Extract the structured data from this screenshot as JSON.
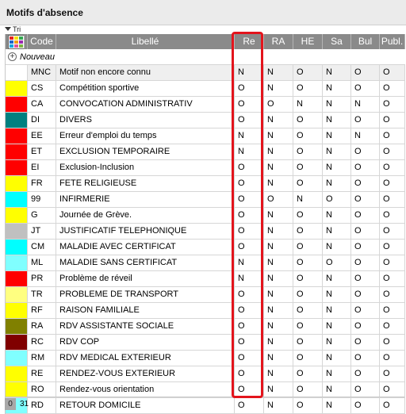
{
  "title": "Motifs d'absence",
  "sort_label": "Tri",
  "new_label": "Nouveau",
  "columns": [
    "Code",
    "Libellé",
    "Re",
    "RA",
    "HE",
    "Sa",
    "Bul",
    "Publ."
  ],
  "palette_colors": [
    "#e52421",
    "#f6e200",
    "#34a853",
    "#1e63c9",
    "#f39c12",
    "#9b27b0",
    "#00a3e0",
    "#e05297",
    "#7cb342"
  ],
  "rows": [
    {
      "color": "#ffffff",
      "code": "MNC",
      "label": "Motif non encore connu",
      "re": "N",
      "ra": "N",
      "he": "O",
      "sa": "N",
      "bul": "O",
      "publ": "O"
    },
    {
      "color": "#ffff00",
      "code": "CS",
      "label": "Compétition sportive",
      "re": "O",
      "ra": "N",
      "he": "O",
      "sa": "N",
      "bul": "O",
      "publ": "O"
    },
    {
      "color": "#ff0000",
      "code": "CA",
      "label": "CONVOCATION ADMINISTRATIV",
      "re": "O",
      "ra": "O",
      "he": "N",
      "sa": "N",
      "bul": "N",
      "publ": "O"
    },
    {
      "color": "#008080",
      "code": "DI",
      "label": "DIVERS",
      "re": "O",
      "ra": "N",
      "he": "O",
      "sa": "N",
      "bul": "O",
      "publ": "O"
    },
    {
      "color": "#ff0000",
      "code": "EE",
      "label": "Erreur d'emploi du temps",
      "re": "N",
      "ra": "N",
      "he": "O",
      "sa": "N",
      "bul": "N",
      "publ": "O"
    },
    {
      "color": "#ff0000",
      "code": "ET",
      "label": "EXCLUSION TEMPORAIRE",
      "re": "N",
      "ra": "N",
      "he": "O",
      "sa": "N",
      "bul": "O",
      "publ": "O"
    },
    {
      "color": "#ff0000",
      "code": "EI",
      "label": "Exclusion-Inclusion",
      "re": "O",
      "ra": "N",
      "he": "O",
      "sa": "N",
      "bul": "O",
      "publ": "O"
    },
    {
      "color": "#ffff00",
      "code": "FR",
      "label": "FETE RELIGIEUSE",
      "re": "O",
      "ra": "N",
      "he": "O",
      "sa": "N",
      "bul": "O",
      "publ": "O"
    },
    {
      "color": "#00ffff",
      "code": "99",
      "label": "INFIRMERIE",
      "re": "O",
      "ra": "O",
      "he": "N",
      "sa": "O",
      "bul": "O",
      "publ": "O"
    },
    {
      "color": "#ffff00",
      "code": "G",
      "label": "Journée de Grève.",
      "re": "O",
      "ra": "N",
      "he": "O",
      "sa": "N",
      "bul": "O",
      "publ": "O"
    },
    {
      "color": "#c0c0c0",
      "code": "JT",
      "label": "JUSTIFICATIF TELEPHONIQUE",
      "re": "O",
      "ra": "N",
      "he": "O",
      "sa": "N",
      "bul": "O",
      "publ": "O"
    },
    {
      "color": "#00ffff",
      "code": "CM",
      "label": "MALADIE AVEC CERTIFICAT",
      "re": "O",
      "ra": "N",
      "he": "O",
      "sa": "N",
      "bul": "O",
      "publ": "O"
    },
    {
      "color": "#80ffff",
      "code": "ML",
      "label": "MALADIE SANS CERTIFICAT",
      "re": "N",
      "ra": "N",
      "he": "O",
      "sa": "O",
      "bul": "O",
      "publ": "O"
    },
    {
      "color": "#ff0000",
      "code": "PR",
      "label": "Problème de réveil",
      "re": "N",
      "ra": "N",
      "he": "O",
      "sa": "N",
      "bul": "O",
      "publ": "O"
    },
    {
      "color": "#ffff80",
      "code": "TR",
      "label": "PROBLEME DE TRANSPORT",
      "re": "O",
      "ra": "N",
      "he": "O",
      "sa": "N",
      "bul": "O",
      "publ": "O"
    },
    {
      "color": "#ffff00",
      "code": "RF",
      "label": "RAISON FAMILIALE",
      "re": "O",
      "ra": "N",
      "he": "O",
      "sa": "N",
      "bul": "O",
      "publ": "O"
    },
    {
      "color": "#808000",
      "code": "RA",
      "label": "RDV ASSISTANTE SOCIALE",
      "re": "O",
      "ra": "N",
      "he": "O",
      "sa": "N",
      "bul": "O",
      "publ": "O"
    },
    {
      "color": "#800000",
      "code": "RC",
      "label": "RDV COP",
      "re": "O",
      "ra": "N",
      "he": "O",
      "sa": "N",
      "bul": "O",
      "publ": "O"
    },
    {
      "color": "#80ffff",
      "code": "RM",
      "label": "RDV MEDICAL EXTERIEUR",
      "re": "O",
      "ra": "N",
      "he": "O",
      "sa": "N",
      "bul": "O",
      "publ": "O"
    },
    {
      "color": "#ffff00",
      "code": "RE",
      "label": "RENDEZ-VOUS EXTERIEUR",
      "re": "O",
      "ra": "N",
      "he": "O",
      "sa": "N",
      "bul": "O",
      "publ": "O"
    },
    {
      "color": "#ffff00",
      "code": "RO",
      "label": "Rendez-vous orientation",
      "re": "O",
      "ra": "N",
      "he": "O",
      "sa": "N",
      "bul": "O",
      "publ": "O"
    },
    {
      "color": "#80ffff",
      "code": "RD",
      "label": "RETOUR DOMICILE",
      "re": "O",
      "ra": "N",
      "he": "O",
      "sa": "N",
      "bul": "O",
      "publ": "O"
    }
  ],
  "footer": {
    "zero": "0",
    "count": "31",
    "scroll_left": "<"
  }
}
